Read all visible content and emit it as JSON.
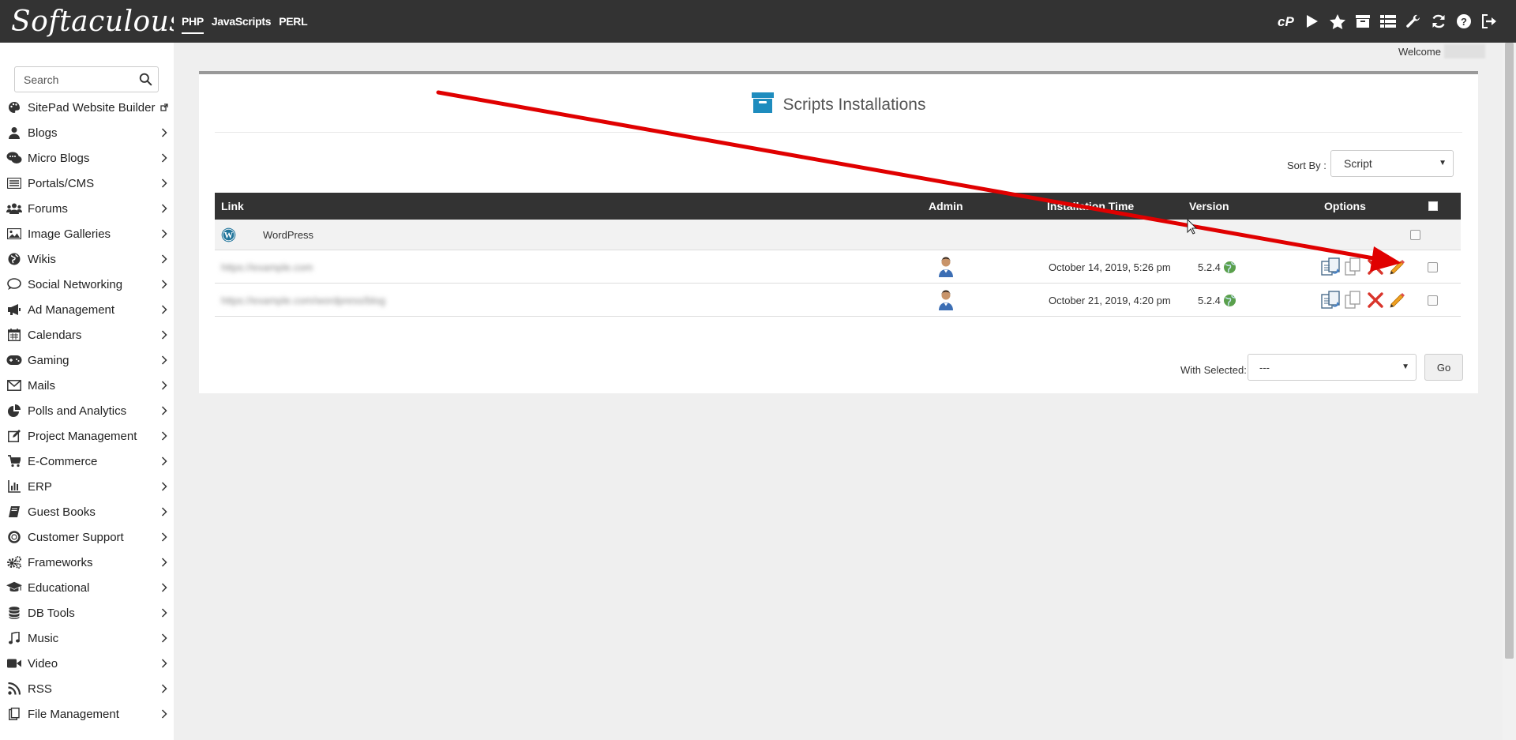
{
  "app": {
    "logo": "Softaculous"
  },
  "search": {
    "placeholder": "Search"
  },
  "sidebar": {
    "items": [
      {
        "label": "SitePad Website Builder",
        "icon": "palette-icon",
        "trailing": "external-link-icon"
      },
      {
        "label": "Blogs",
        "icon": "user-icon",
        "trailing": "chevron-right-icon"
      },
      {
        "label": "Micro Blogs",
        "icon": "comments-icon",
        "trailing": "chevron-right-icon"
      },
      {
        "label": "Portals/CMS",
        "icon": "list-icon",
        "trailing": "chevron-right-icon"
      },
      {
        "label": "Forums",
        "icon": "users-icon",
        "trailing": "chevron-right-icon"
      },
      {
        "label": "Image Galleries",
        "icon": "image-icon",
        "trailing": "chevron-right-icon"
      },
      {
        "label": "Wikis",
        "icon": "globe-icon",
        "trailing": "chevron-right-icon"
      },
      {
        "label": "Social Networking",
        "icon": "chat-icon",
        "trailing": "chevron-right-icon"
      },
      {
        "label": "Ad Management",
        "icon": "bullhorn-icon",
        "trailing": "chevron-right-icon"
      },
      {
        "label": "Calendars",
        "icon": "calendar-icon",
        "trailing": "chevron-right-icon"
      },
      {
        "label": "Gaming",
        "icon": "gamepad-icon",
        "trailing": "chevron-right-icon"
      },
      {
        "label": "Mails",
        "icon": "envelope-icon",
        "trailing": "chevron-right-icon"
      },
      {
        "label": "Polls and Analytics",
        "icon": "pie-chart-icon",
        "trailing": "chevron-right-icon"
      },
      {
        "label": "Project Management",
        "icon": "edit-icon",
        "trailing": "chevron-right-icon"
      },
      {
        "label": "E-Commerce",
        "icon": "cart-icon",
        "trailing": "chevron-right-icon"
      },
      {
        "label": "ERP",
        "icon": "bar-chart-icon",
        "trailing": "chevron-right-icon"
      },
      {
        "label": "Guest Books",
        "icon": "book-icon",
        "trailing": "chevron-right-icon"
      },
      {
        "label": "Customer Support",
        "icon": "lifebuoy-icon",
        "trailing": "chevron-right-icon"
      },
      {
        "label": "Frameworks",
        "icon": "cogs-icon",
        "trailing": "chevron-right-icon"
      },
      {
        "label": "Educational",
        "icon": "graduation-cap-icon",
        "trailing": "chevron-right-icon"
      },
      {
        "label": "DB Tools",
        "icon": "database-icon",
        "trailing": "chevron-right-icon"
      },
      {
        "label": "Music",
        "icon": "music-icon",
        "trailing": "chevron-right-icon"
      },
      {
        "label": "Video",
        "icon": "video-icon",
        "trailing": "chevron-right-icon"
      },
      {
        "label": "RSS",
        "icon": "rss-icon",
        "trailing": "chevron-right-icon"
      },
      {
        "label": "File Management",
        "icon": "file-icon",
        "trailing": "chevron-right-icon"
      }
    ]
  },
  "topbar": {
    "tabs": [
      {
        "label": "PHP",
        "active": true
      },
      {
        "label": "JavaScripts",
        "active": false
      },
      {
        "label": "PERL",
        "active": false
      }
    ],
    "icons": [
      "cpanel-icon",
      "play-icon",
      "star-icon",
      "archive-icon",
      "list-view-icon",
      "wrench-icon",
      "refresh-icon",
      "help-icon",
      "logout-icon"
    ]
  },
  "welcome": {
    "label": "Welcome"
  },
  "panel": {
    "title": "Scripts Installations",
    "sort_label": "Sort By :",
    "sort_value": "Script"
  },
  "table": {
    "headers": {
      "link": "Link",
      "admin": "Admin",
      "installation_time": "Installation Time",
      "version": "Version",
      "options": "Options"
    },
    "group": {
      "name": "WordPress",
      "icon": "wordpress-icon"
    },
    "rows": [
      {
        "link": "https://example.com",
        "installation_time": "October 14, 2019, 5:26 pm",
        "version": "5.2.4"
      },
      {
        "link": "https://example.com/wordpress/blog",
        "installation_time": "October 21, 2019, 4:20 pm",
        "version": "5.2.4"
      }
    ]
  },
  "bulk": {
    "label": "With Selected:",
    "value": "---",
    "go_label": "Go"
  },
  "colors": {
    "topbar": "#333333",
    "accent": "#1e8cbe",
    "annotation_arrow": "#e00000"
  }
}
